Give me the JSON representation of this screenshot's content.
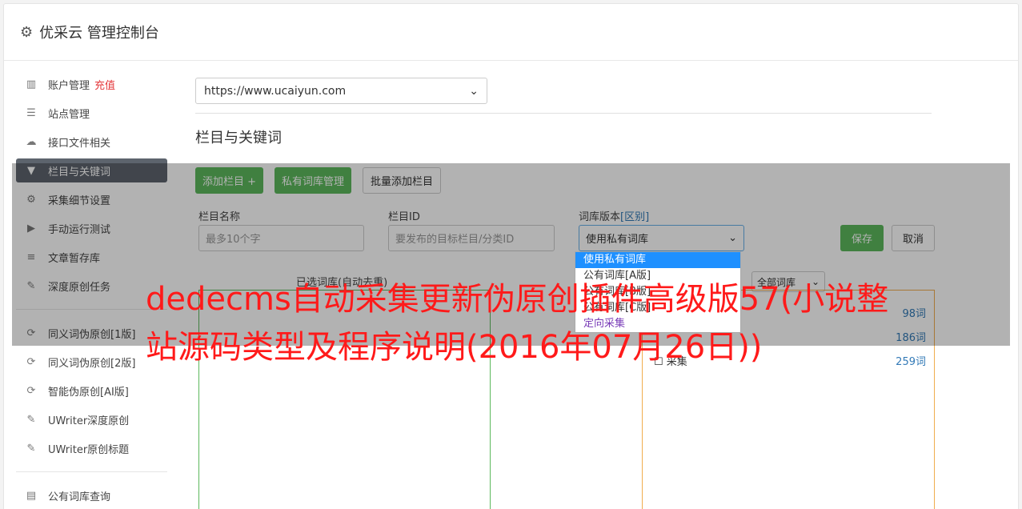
{
  "header": {
    "title": "优采云 管理控制台"
  },
  "sidebar": {
    "items": [
      {
        "label": "账户管理",
        "badge": "充值",
        "icon": "bar-chart-icon"
      },
      {
        "label": "站点管理",
        "icon": "server-icon"
      },
      {
        "label": "接口文件相关",
        "icon": "cloud-upload-icon"
      },
      {
        "label": "栏目与关键词",
        "icon": "filter-icon",
        "active": true
      },
      {
        "label": "采集细节设置",
        "icon": "gears-icon"
      },
      {
        "label": "手动运行测试",
        "icon": "play-icon"
      },
      {
        "label": "文章暂存库",
        "icon": "database-icon"
      },
      {
        "label": "深度原创任务",
        "icon": "edit-icon"
      }
    ],
    "items2": [
      {
        "label": "同义词伪原创[1版]",
        "icon": "refresh-icon"
      },
      {
        "label": "同义词伪原创[2版]",
        "icon": "refresh-icon"
      },
      {
        "label": "智能伪原创[AI版]",
        "icon": "refresh-icon"
      },
      {
        "label": "UWriter深度原创",
        "icon": "edit-icon"
      },
      {
        "label": "UWriter原创标题",
        "icon": "edit-icon"
      }
    ],
    "items3": [
      {
        "label": "公有词库查询",
        "icon": "book-icon"
      }
    ]
  },
  "main": {
    "site_select_value": "https://www.ucaiyun.com",
    "section_title": "栏目与关键词",
    "buttons": {
      "add_column": "添加栏目 +",
      "private_lib": "私有词库管理",
      "batch_add": "批量添加栏目"
    },
    "form": {
      "name_label": "栏目名称",
      "name_placeholder": "最多10个字",
      "id_label": "栏目ID",
      "id_placeholder": "要发布的目标栏目/分类ID",
      "version_label": "词库版本",
      "version_link": "[区别]",
      "version_value": "使用私有词库",
      "save": "保存",
      "cancel": "取消"
    },
    "dropdown_options": [
      "使用私有词库",
      "公有词库[A版]",
      "公有词库[B版]",
      "公有词库[C版]",
      "定向采集"
    ],
    "selected_label": "已选词库(自动去重)",
    "filter_value": "全部词库",
    "library_rows": [
      {
        "name": "",
        "count": "98词"
      },
      {
        "name": "",
        "count": "186词"
      },
      {
        "name": "采集",
        "count": "259词"
      }
    ]
  },
  "headline": "dedecms自动采集更新伪原创插件高级版57(小说整站源码类型及程序说明(2016年07月26日))",
  "colors": {
    "accent_green": "#5cb85c",
    "headline_red": "#ff1a1a",
    "active_nav": "#5d646d"
  }
}
